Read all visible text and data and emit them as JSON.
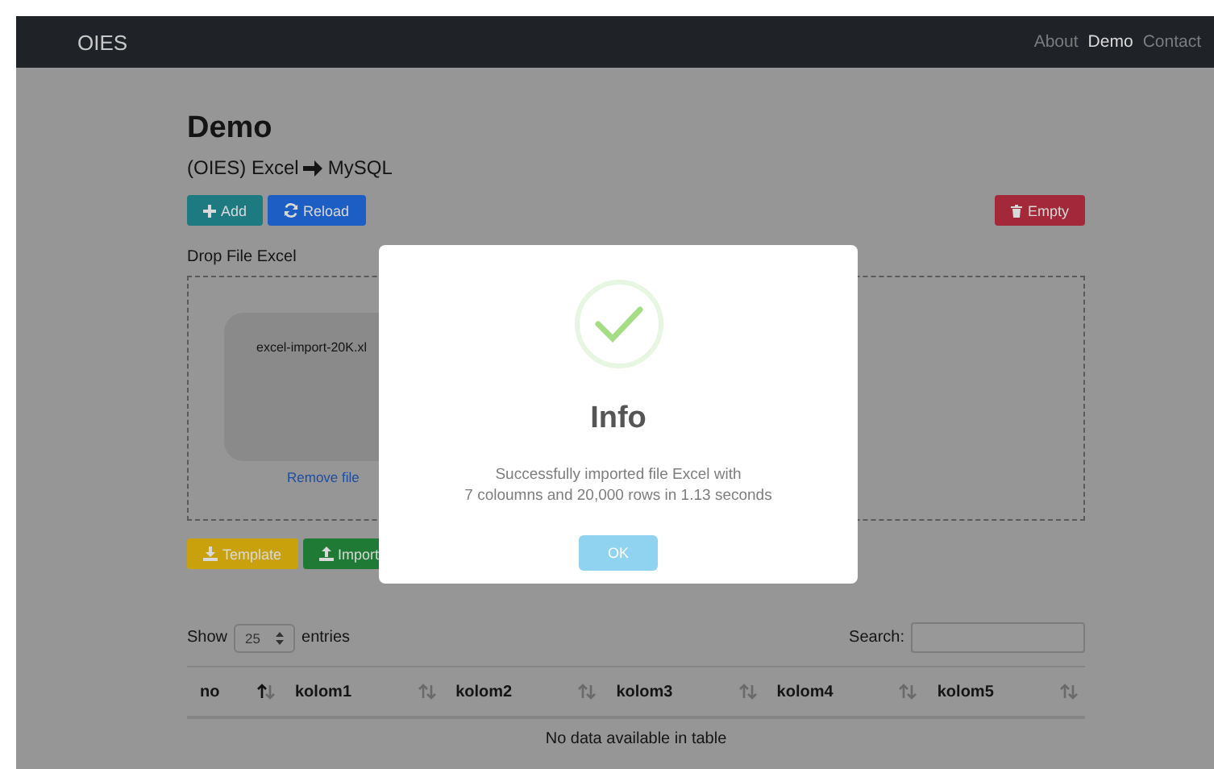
{
  "navbar": {
    "brand": "OIES",
    "links": [
      {
        "label": "About",
        "selected": false
      },
      {
        "label": "Demo",
        "selected": true
      },
      {
        "label": "Contact",
        "selected": false
      }
    ]
  },
  "page": {
    "title": "Demo",
    "subtitle_left": "(OIES) Excel",
    "subtitle_right": "MySQL"
  },
  "toolbar": {
    "buttons": [
      {
        "label": "Add",
        "kind": "add"
      },
      {
        "label": "Reload",
        "kind": "reload"
      }
    ],
    "danger_button": {
      "label": "Empty",
      "kind": "trash"
    }
  },
  "dropzone": {
    "label": "Drop File Excel",
    "file_name": "excel-import-20K.xl",
    "remove_link": "Remove file"
  },
  "actions": [
    {
      "label": "Template",
      "kind": "template"
    },
    {
      "label": "Import",
      "kind": "import"
    }
  ],
  "table": {
    "length_label_before": "Show",
    "length_value": "25",
    "length_label_after": "entries",
    "search_label": "Search:",
    "columns": [
      {
        "label": "no",
        "sorted": true
      },
      {
        "label": "kolom1",
        "sorted": false
      },
      {
        "label": "kolom2",
        "sorted": false
      },
      {
        "label": "kolom3",
        "sorted": false
      },
      {
        "label": "kolom4",
        "sorted": false
      },
      {
        "label": "kolom5",
        "sorted": false
      }
    ],
    "empty_message": "No data available in table"
  },
  "dialog": {
    "title": "Info",
    "message_lines": [
      "Successfully imported file Excel with",
      "7 coloumns and 20,000 rows in 1.13 seconds"
    ],
    "button": "OK"
  }
}
